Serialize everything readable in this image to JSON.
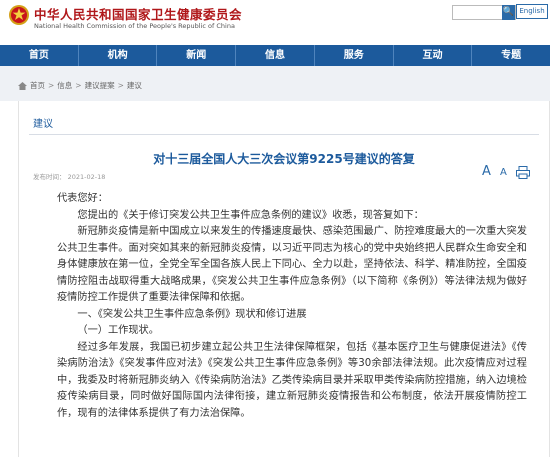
{
  "header": {
    "title": "中华人民共和国国家卫生健康委员会",
    "subtitle": "National Health Commission of the People's Republic of China",
    "search_button": "🔍",
    "english_link": "English"
  },
  "nav": {
    "items": [
      {
        "label": "首页"
      },
      {
        "label": "机构"
      },
      {
        "label": "新闻"
      },
      {
        "label": "信息"
      },
      {
        "label": "服务"
      },
      {
        "label": "互动"
      },
      {
        "label": "专题"
      }
    ]
  },
  "breadcrumb": {
    "items": [
      "首页",
      "信息",
      "建议提案",
      "建议"
    ]
  },
  "section": {
    "tab_label": "建议"
  },
  "article": {
    "title": "对十三届全国人大三次会议第9225号建议的答复",
    "publish_date": "发布时间：  2021-02-18",
    "font_large": "A",
    "font_small": "A",
    "paragraphs": [
      "代表您好：",
      "您提出的《关于修订突发公共卫生事件应急条例的建议》收悉，现答复如下：",
      "新冠肺炎疫情是新中国成立以来发生的传播速度最快、感染范围最广、防控难度最大的一次重大突发公共卫生事件。面对突如其来的新冠肺炎疫情，以习近平同志为核心的党中央始终把人民群众生命安全和身体健康放在第一位，全党全军全国各族人民上下同心、全力以赴，坚持依法、科学、精准防控，全国疫情防控阻击战取得重大战略成果，《突发公共卫生事件应急条例》（以下简称《条例》）等法律法规为做好疫情防控工作提供了重要法律保障和依据。",
      "一、《突发公共卫生事件应急条例》现状和修订进展",
      "（一）工作现状。",
      "经过多年发展，我国已初步建立起公共卫生法律保障框架，包括《基本医疗卫生与健康促进法》《传染病防治法》《突发事件应对法》《突发公共卫生事件应急条例》等30余部法律法规。此次疫情应对过程中，我委及时将新冠肺炎纳入《传染病防治法》乙类传染病目录并采取甲类传染病防控措施，纳入边境检疫传染病目录，同时做好国际国内法律衔接，建立新冠肺炎疫情报告和公布制度，依法开展疫情防控工作，现有的法律体系提供了有力法治保障。"
    ]
  }
}
